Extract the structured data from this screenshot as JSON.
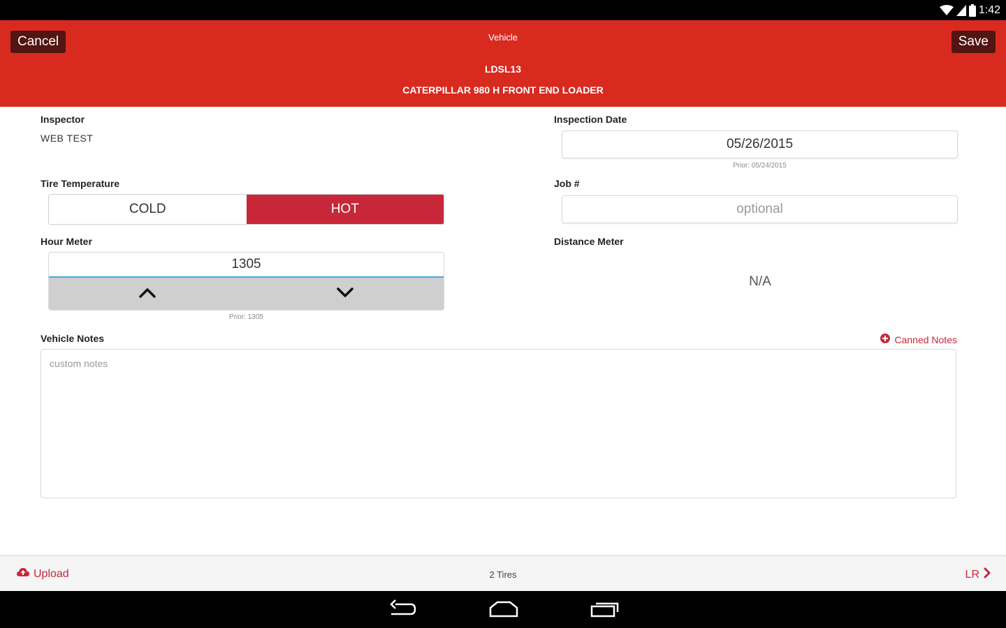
{
  "status_bar": {
    "time": "1:42",
    "icons": [
      "wifi-icon",
      "signal-icon",
      "battery-icon"
    ]
  },
  "header": {
    "cancel_label": "Cancel",
    "title": "Vehicle",
    "vehicle_id": "LDSL13",
    "vehicle_desc": "CATERPILLAR 980 H FRONT END LOADER",
    "save_label": "Save",
    "color": "#d92a20"
  },
  "inspector": {
    "label": "Inspector",
    "value": "WEB TEST"
  },
  "inspection_date": {
    "label": "Inspection Date",
    "value": "05/26/2015",
    "prior": "Prior: 05/24/2015"
  },
  "tire_temperature": {
    "label": "Tire Temperature",
    "options": [
      "COLD",
      "HOT"
    ],
    "selected": "HOT",
    "selected_color": "#c8273a"
  },
  "job": {
    "label": "Job #",
    "placeholder": "optional"
  },
  "hour_meter": {
    "label": "Hour Meter",
    "value": "1305",
    "prior": "Prior: 1305",
    "icons": [
      "chevron-up-icon",
      "chevron-down-icon"
    ]
  },
  "distance_meter": {
    "label": "Distance Meter",
    "value": "N/A"
  },
  "vehicle_notes": {
    "label": "Vehicle Notes",
    "placeholder": "custom notes",
    "canned_notes_label": "Canned Notes",
    "canned_icon": "add-circle-icon"
  },
  "footer": {
    "upload_label": "Upload",
    "upload_icon": "cloud-upload-icon",
    "tires_label": "2 Tires",
    "next_label": "LR",
    "next_icon": "chevron-right-icon"
  },
  "nav_bar": {
    "icons": [
      "back-icon",
      "home-icon",
      "recents-icon"
    ]
  }
}
